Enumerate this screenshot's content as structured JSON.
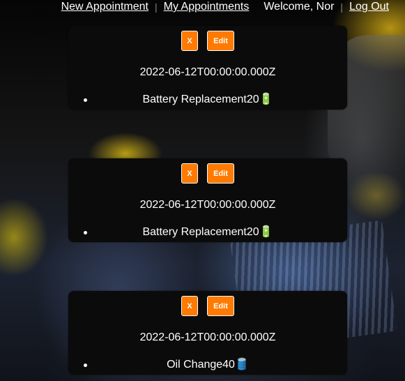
{
  "nav": {
    "new_appointment": "New Appointment",
    "sep1": "|",
    "my_appointments": "My Appointments",
    "welcome": "Welcome, Nor",
    "sep2": "|",
    "log_out": "Log Out"
  },
  "appointments": [
    {
      "delete_label": "X",
      "edit_label": "Edit",
      "date": "2022-06-12T00:00:00.000Z",
      "service": "Battery Replacement20",
      "service_icon": "🔋"
    },
    {
      "delete_label": "X",
      "edit_label": "Edit",
      "date": "2022-06-12T00:00:00.000Z",
      "service": "Battery Replacement20",
      "service_icon": "🔋"
    },
    {
      "delete_label": "X",
      "edit_label": "Edit",
      "date": "2022-06-12T00:00:00.000Z",
      "service": "Oil Change40",
      "service_icon": "🛢️"
    }
  ],
  "colors": {
    "accent": "#ff7a00",
    "card_bg": "#0b0b0b",
    "text": "#ffffff"
  }
}
